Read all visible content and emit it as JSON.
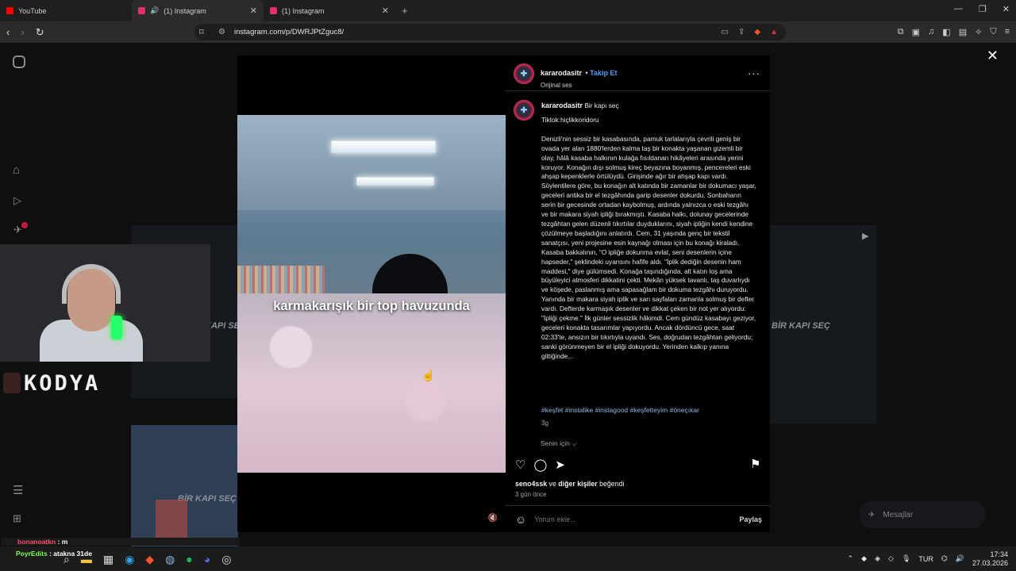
{
  "browser": {
    "tabs": [
      {
        "title": "YouTube",
        "fav_color": "#ff0000"
      },
      {
        "title": "(1) Instagram",
        "fav_color": "#e1306c",
        "audio": "🔊"
      },
      {
        "title": "(1) Instagram",
        "fav_color": "#e1306c"
      }
    ],
    "url": "instagram.com/p/DWRJPtZguc8/"
  },
  "video": {
    "caption": "karmakarışık bir top havuzunda"
  },
  "post": {
    "username": "kararodasitr",
    "follow_label": "Takip Et",
    "audio": "Orijinal ses",
    "caption_title": "Bir kapı seç",
    "tiktok": "Tiktok:hiçlikkoridoru",
    "body": "Denizli'nin sessiz bir kasabasında, pamuk tarlalarıyla çevrili geniş bir ovada yer alan 1880'lerden kalma taş bir konakta yaşanan gizemli bir olay, hâlâ kasaba halkının kulağa fısıldanan hikâyeleri arasında yerini koruyor. Konağın dışı solmuş kireç beyazına boyanmış, pencereleri eski ahşap kepenklerle örtülüydü. Girişinde ağır bir ahşap kapı vardı. Söylentilere göre, bu konağın alt katında bir zamanlar bir dokumacı yaşar, geceleri antika bir el tezgâhında garip desenler dokurdu. Sonbaharın serin bir gecesinde ortadan kaybolmuş, ardında yalnızca o eski tezgâhı ve bir makara siyah ipliği bırakmıştı. Kasaba halkı, dolunay gecelerinde tezgâhtan gelen düzenli tıkırtılar duyduklarını, siyah ipliğin kendi kendine çözülmeye başladığını anlatırdı. Cem, 31 yaşında genç bir tekstil sanatçısı, yeni projesine esin kaynağı olması için bu konağı kiraladı. Kasaba bakkalının, \"O ipliğe dokunma evlat, seni desenlerin içine hapseder,\" şeklindeki uyarısını hafife aldı. \"İplik dediğin desenin ham maddesi,\" diye gülümsedi. Konağa taşındığında, alt katın loş ama büyüleyici atmosferi dikkatini çekti. Mekân yüksek tavanlı, taş duvarlıydı ve köşede, paslanmış ama sapasağlam bir dokuma tezgâhı duruyordu. Yanında bir makara siyah iplik ve sarı sayfaları zamanla solmuş bir defter vardı. Defterde karmaşık desenler ve dikkat çeken bir not yer alıyordu: \"İpliği çekme.\" İlk günler sessizlik hâkimdi. Cem gündüz kasabayı geziyor, geceleri konakta tasarımlar yapıyordu. Ancak dördüncü gece, saat 02:33'te, ansızın bir tıkırtıyla uyandı. Ses, doğrudan tezgâhtan geliyordu; sanki görünmeyen bir el ipliği dokuyordu. Yerinden kalkıp yanına gittiğinde...",
    "hashtags": "#keşfet #instalike #instagood #keşfetteyim #öneçıkar",
    "age": "3g",
    "for_you": "Senin için ⌵",
    "liked_by_user": "seno4ssk",
    "liked_by_rest": " ve ",
    "liked_by_others": "diğer kişiler",
    "liked_suffix": " beğendi",
    "date": "3 gün önce",
    "comment_placeholder": "Yorum ekle...",
    "share_label": "Paylaş"
  },
  "background": {
    "card_text": "BİR KAPI SEÇ"
  },
  "stream": {
    "brand": "KODYA",
    "chat1_user": "bonanoatkn",
    "chat1_msg": ": m",
    "chat2_user": "PoyrEdits",
    "chat2_msg": ": atakna 31de",
    "messages_label": "Mesajlar"
  },
  "taskbar": {
    "lang": "TUR",
    "time": "17:34",
    "date": "27.03.2026"
  }
}
